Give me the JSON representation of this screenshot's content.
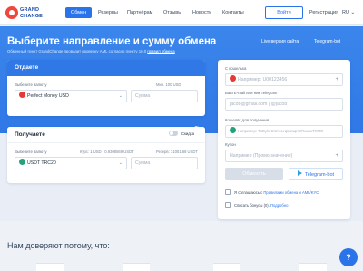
{
  "nav": {
    "logo_line1": "GRAND",
    "logo_line2": "CHANGE",
    "items": [
      "Обмен",
      "Резервы",
      "Партнёрам",
      "Отзывы",
      "Новости",
      "Контакты"
    ],
    "login": "Войти",
    "register": "Регистрация",
    "lang": "RU"
  },
  "hero": {
    "title": "Выберите направление и сумму обмена",
    "subtitle_prefix": "Обменный пункт GrandChange проводит проверку AML согласно пункту 10.0",
    "subtitle_link": "правил обмена",
    "live_chat": "Live версия сайта",
    "telegram_bot_top": "Telegram-bot"
  },
  "give": {
    "header": "Отдаете",
    "currency_label": "Выберите валюту",
    "currency": "Perfect Money USD",
    "amount_placeholder": "Сумма",
    "min_text": "Мин. 100 USD",
    "coin_color": "#e53935"
  },
  "receive": {
    "header": "Получаете",
    "currency_label": "Выберите валюту",
    "rate_text": "Курс: 1 USD - 0.9308569 USDT",
    "currency": "USDT TRC20",
    "amount_placeholder": "Сумма",
    "reserve_text": "Резерв: 71001.68 USDT",
    "discount_label": "Скидка",
    "coin_color": "#26a17b"
  },
  "form": {
    "wallet_label": "С кошелька",
    "wallet_placeholder": "Например: U00123456",
    "email_label": "Ваш E-mail или ник Telegram",
    "email_placeholder": "jacob@gmail.com | @jacob",
    "receive_wallet_label": "Кошелёк для получения",
    "receive_wallet_placeholder": "Например: TnBykeCXmeLrqmJuqrnzRuaaxTXMO",
    "coupon_label": "Купон",
    "coupon_placeholder": "Например (Промо-значение)",
    "exchange_button": "Обменять",
    "telegram_button": "Telegram-bot",
    "agree_prefix": "Я соглашаюсь с",
    "agree_link": "Правилами обмена и AML/KYC",
    "bonus_prefix": "Списать бонусы (0).",
    "bonus_link": "Подробно"
  },
  "trust_title": "Нам доверяют потому, что:",
  "help_icon": "?"
}
